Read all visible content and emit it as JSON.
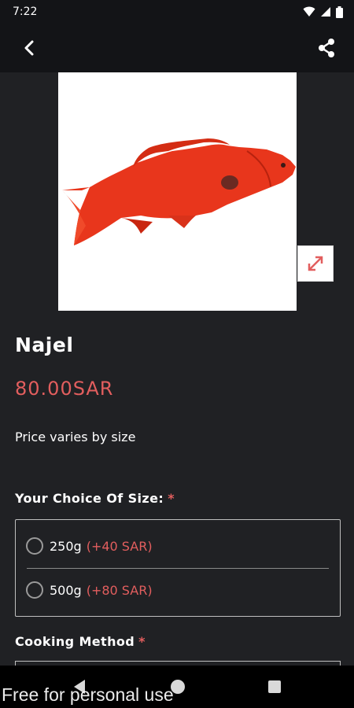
{
  "status_bar": {
    "time": "7:22",
    "icons": [
      "wifi-icon",
      "signal-icon",
      "battery-icon"
    ]
  },
  "app_bar": {
    "back_icon": "back-arrow-icon",
    "share_icon": "share-icon"
  },
  "product": {
    "image": "red-fish-image",
    "name": "Najel",
    "price": "80.00SAR",
    "price_note": "Price varies by size"
  },
  "size_section": {
    "title": "Your Choice Of Size:",
    "required_mark": "*",
    "options": [
      {
        "label": "250g",
        "extra": "(+40 SAR)"
      },
      {
        "label": "500g",
        "extra": "(+80 SAR)"
      }
    ]
  },
  "cooking_section": {
    "title": "Cooking Method",
    "required_mark": "*"
  },
  "watermark": "Free for personal use",
  "colors": {
    "accent": "#e25e5e",
    "background": "#202124",
    "bar": "#131417"
  }
}
